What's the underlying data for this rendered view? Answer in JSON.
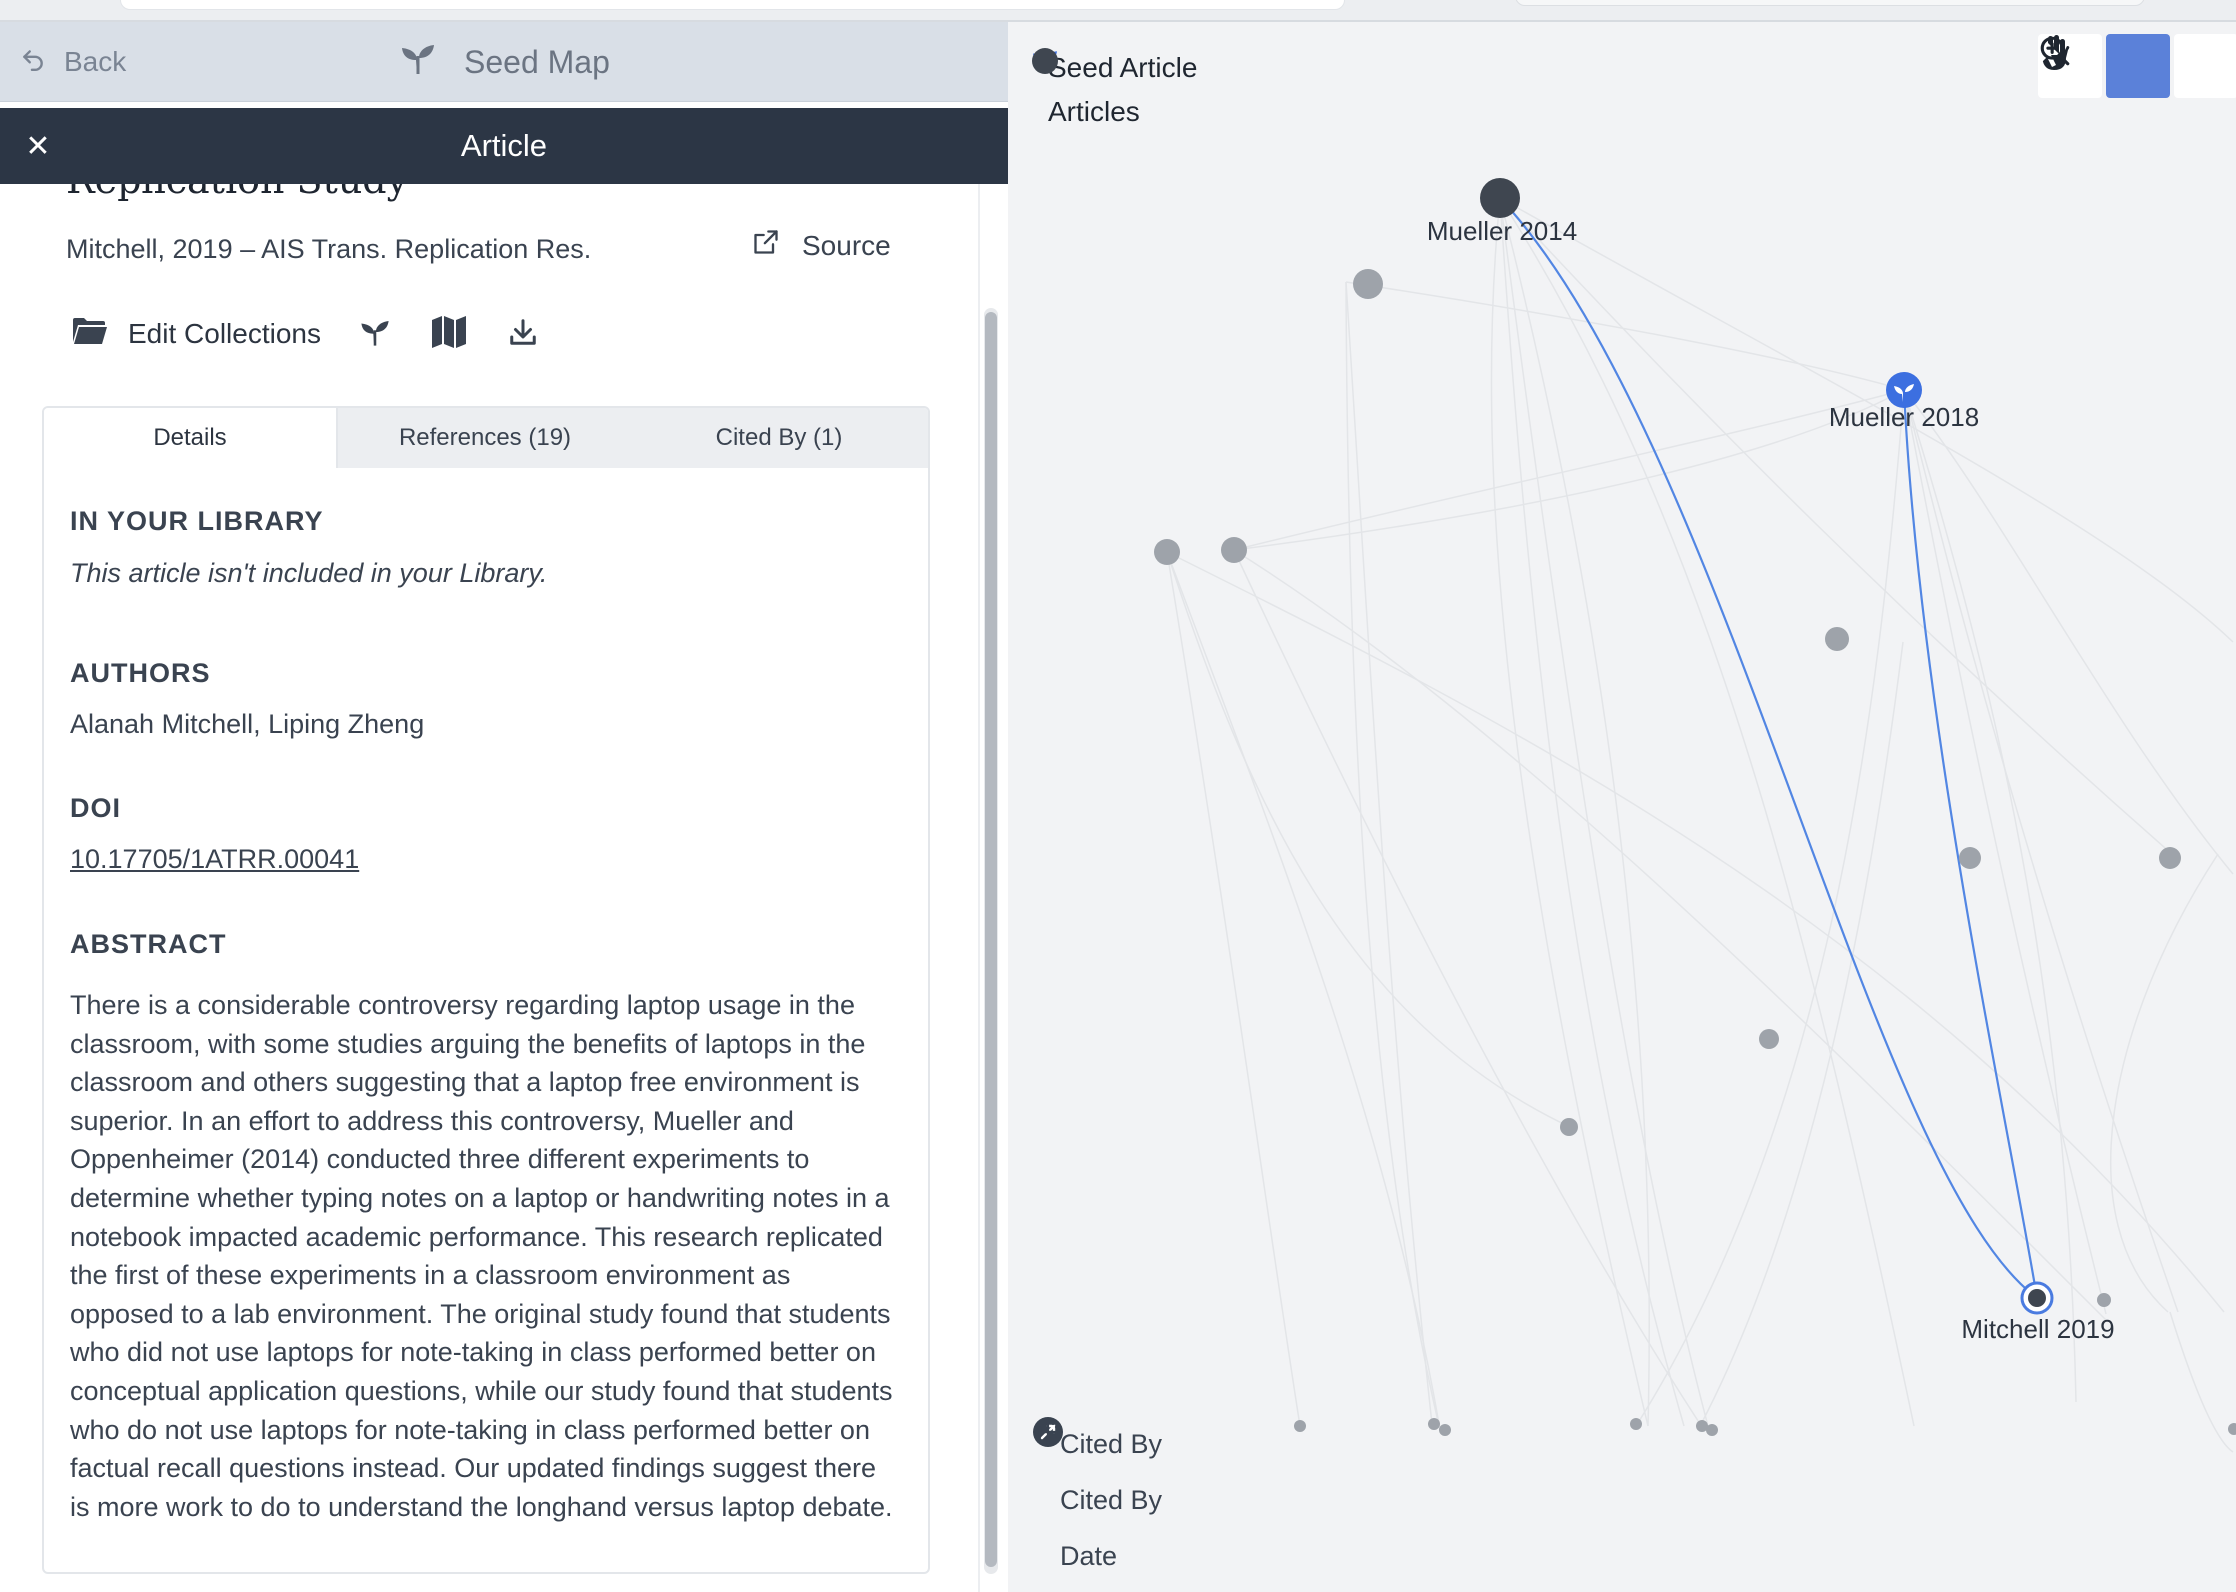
{
  "nav": {
    "back_label": "Back",
    "title": "Seed Map"
  },
  "panel": {
    "header_title": "Article",
    "close_symbol": "✕",
    "paper_title_partial": "Replication Study",
    "citation": "Mitchell, 2019 – AIS Trans. Replication Res.",
    "source_label": "Source",
    "edit_collections_label": "Edit Collections",
    "tabs": [
      {
        "label": "Details",
        "active": true
      },
      {
        "label": "References (19)",
        "active": false
      },
      {
        "label": "Cited By (1)",
        "active": false
      }
    ],
    "library": {
      "heading": "IN YOUR LIBRARY",
      "text": "This article isn't included in your Library."
    },
    "authors": {
      "heading": "AUTHORS",
      "text": "Alanah Mitchell, Liping Zheng"
    },
    "doi": {
      "heading": "DOI",
      "text": "10.17705/1ATRR.00041"
    },
    "abstract": {
      "heading": "ABSTRACT",
      "text": "There is a considerable controversy regarding laptop usage in the classroom, with some studies arguing the benefits of laptops in the classroom and others suggesting that a laptop free environment is superior. In an effort to address this controversy, Mueller and Oppenheimer (2014) conducted three different experiments to determine whether typing notes on a laptop or handwriting notes in a notebook impacted academic performance. This research replicated the first of these experiments in a classroom environment as opposed to a lab environment. The original study found that students who did not use laptops for note-taking in class performed better on conceptual application questions, while our study found that students who do not use laptops for note-taking in class performed better on factual recall questions instead. Our updated findings suggest there is more work to do to understand the longhand versus laptop debate."
    }
  },
  "graph": {
    "legend": {
      "seed_label": "Seed Article",
      "articles_label": "Articles"
    },
    "tools": [
      "hand-icon",
      "pointer-icon",
      "zoom-in-icon"
    ],
    "active_tool": "pointer-icon",
    "bottom_legend": [
      {
        "icon": "cited-by-circle-icon",
        "label": "Cited By"
      },
      {
        "icon": "vertical-arrow-icon",
        "label": "Cited By"
      },
      {
        "icon": "horizontal-arrow-icon",
        "label": "Date"
      }
    ],
    "labeled_nodes": [
      "Mueller 2014",
      "Mueller 2018",
      "Mitchell 2019"
    ],
    "colors": {
      "accent": "#4a7be0",
      "node": "#9ea3aa",
      "node_dark": "#3f4650",
      "header": "#2c3645"
    }
  }
}
